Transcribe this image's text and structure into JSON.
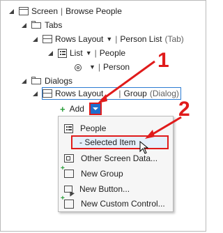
{
  "tree": {
    "screen": {
      "label": "Screen",
      "sep": "|",
      "name": "Browse People"
    },
    "tabs": {
      "label": "Tabs"
    },
    "rows_layout_tab": {
      "label": "Rows Layout",
      "sep": "|",
      "name": "Person List",
      "suffix": "(Tab)"
    },
    "list": {
      "label": "List",
      "sep": "|",
      "name": "People"
    },
    "person": {
      "sep": "|",
      "name": "Person"
    },
    "dialogs": {
      "label": "Dialogs"
    },
    "rows_layout_dialog": {
      "label": "Rows Layout",
      "sep": "|",
      "name": "Group",
      "suffix": "(Dialog)"
    },
    "add": {
      "label": "Add"
    }
  },
  "menu": {
    "items": [
      {
        "label": "People",
        "icon": "list-icon"
      },
      {
        "label": "- Selected Item",
        "icon": ""
      },
      {
        "label": "Other Screen Data...",
        "icon": "screen-data-icon"
      },
      {
        "label": "New Group",
        "icon": "new-group-icon"
      },
      {
        "label": "New Button...",
        "icon": "new-button-icon"
      },
      {
        "label": "New Custom Control...",
        "icon": "new-custom-control-icon"
      }
    ]
  },
  "callouts": {
    "one": "1",
    "two": "2"
  },
  "colors": {
    "callout": "#e01b1b",
    "selection_border": "#2b7bd2",
    "dropdown": "#1f6fce",
    "add_plus": "#2a9d3a"
  }
}
